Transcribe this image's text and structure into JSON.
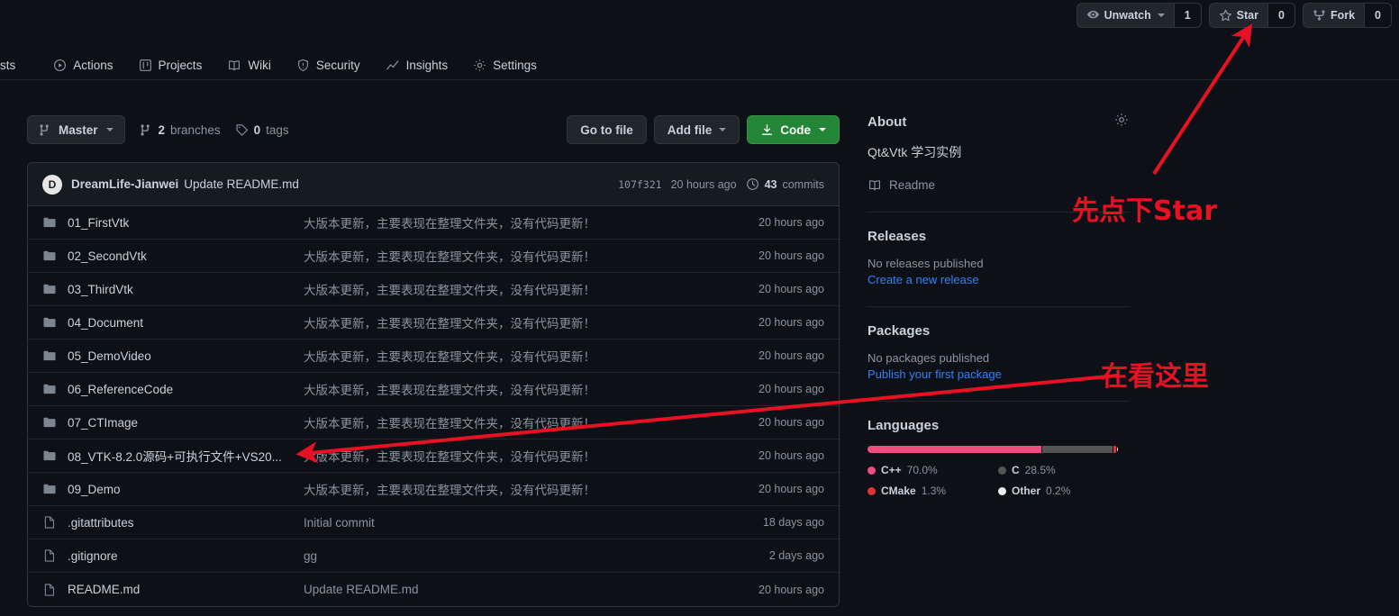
{
  "top_actions": {
    "unwatch": {
      "label": "Unwatch",
      "count": "1",
      "icon": "eye-icon"
    },
    "star": {
      "label": "Star",
      "count": "0",
      "icon": "star-icon"
    },
    "fork": {
      "label": "Fork",
      "count": "0",
      "icon": "fork-icon"
    }
  },
  "repo_nav": {
    "truncated_first": "sts",
    "items": [
      {
        "label": "Actions",
        "icon": "play-circle-icon"
      },
      {
        "label": "Projects",
        "icon": "project-board-icon"
      },
      {
        "label": "Wiki",
        "icon": "book-icon"
      },
      {
        "label": "Security",
        "icon": "shield-icon"
      },
      {
        "label": "Insights",
        "icon": "graph-icon"
      },
      {
        "label": "Settings",
        "icon": "gear-icon"
      }
    ]
  },
  "branch_row": {
    "branch": "Master",
    "branches_count": "2",
    "branches_label": "branches",
    "tags_count": "0",
    "tags_label": "tags",
    "go_to_file": "Go to file",
    "add_file": "Add file",
    "code": "Code"
  },
  "commit_head": {
    "avatar_initial": "D",
    "author": "DreamLife-Jianwei",
    "message": "Update README.md",
    "sha": "107f321",
    "time": "20 hours ago",
    "commits_count": "43",
    "commits_label": "commits"
  },
  "files": [
    {
      "name": "01_FirstVtk",
      "type": "folder",
      "message": "大版本更新，主要表现在整理文件夹，没有代码更新！",
      "time": "20 hours ago"
    },
    {
      "name": "02_SecondVtk",
      "type": "folder",
      "message": "大版本更新，主要表现在整理文件夹，没有代码更新！",
      "time": "20 hours ago"
    },
    {
      "name": "03_ThirdVtk",
      "type": "folder",
      "message": "大版本更新，主要表现在整理文件夹，没有代码更新！",
      "time": "20 hours ago"
    },
    {
      "name": "04_Document",
      "type": "folder",
      "message": "大版本更新，主要表现在整理文件夹，没有代码更新！",
      "time": "20 hours ago"
    },
    {
      "name": "05_DemoVideo",
      "type": "folder",
      "message": "大版本更新，主要表现在整理文件夹，没有代码更新！",
      "time": "20 hours ago"
    },
    {
      "name": "06_ReferenceCode",
      "type": "folder",
      "message": "大版本更新，主要表现在整理文件夹，没有代码更新！",
      "time": "20 hours ago"
    },
    {
      "name": "07_CTImage",
      "type": "folder",
      "message": "大版本更新，主要表现在整理文件夹，没有代码更新！",
      "time": "20 hours ago"
    },
    {
      "name": "08_VTK-8.2.0源码+可执行文件+VS20...",
      "type": "folder",
      "message": "大版本更新，主要表现在整理文件夹，没有代码更新！",
      "time": "20 hours ago"
    },
    {
      "name": "09_Demo",
      "type": "folder",
      "message": "大版本更新，主要表现在整理文件夹，没有代码更新！",
      "time": "20 hours ago"
    },
    {
      "name": ".gitattributes",
      "type": "file",
      "message": "Initial commit",
      "time": "18 days ago"
    },
    {
      "name": ".gitignore",
      "type": "file",
      "message": "gg",
      "time": "2 days ago"
    },
    {
      "name": "README.md",
      "type": "file",
      "message": "Update README.md",
      "time": "20 hours ago"
    }
  ],
  "sidebar": {
    "about_title": "About",
    "description": "Qt&Vtk 学习实例",
    "readme_label": "Readme",
    "releases_title": "Releases",
    "releases_empty": "No releases published",
    "releases_link": "Create a new release",
    "packages_title": "Packages",
    "packages_empty": "No packages published",
    "packages_link": "Publish your first package",
    "languages_title": "Languages"
  },
  "chart_data": {
    "type": "bar",
    "title": "Languages",
    "categories": [
      "C++",
      "C",
      "CMake",
      "Other"
    ],
    "values": [
      70.0,
      28.5,
      1.3,
      0.2
    ],
    "labels": [
      "70.0%",
      "28.5%",
      "1.3%",
      "0.2%"
    ],
    "colors": [
      "#f34b7d",
      "#555555",
      "#da3434",
      "#ededed"
    ],
    "legend": "bottom",
    "ylabel": "percent"
  },
  "annotations": [
    {
      "id": "annot-star",
      "text": "先点下Star",
      "color": "#e81123"
    },
    {
      "id": "annot-here",
      "text": "在看这里",
      "color": "#e81123"
    }
  ]
}
